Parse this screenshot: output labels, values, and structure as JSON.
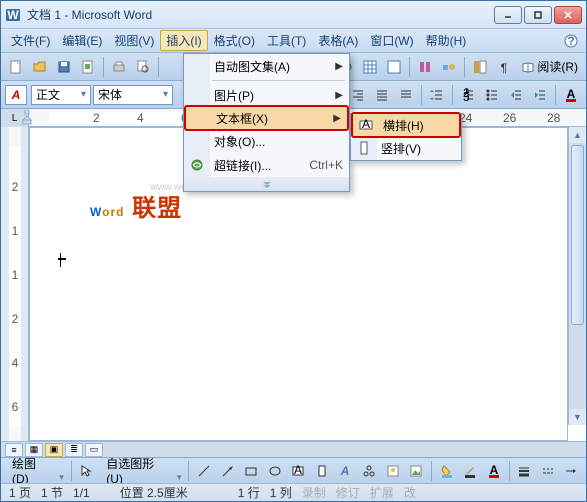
{
  "title": "文档 1 - Microsoft Word",
  "menubar": {
    "file": "文件(F)",
    "edit": "编辑(E)",
    "view": "视图(V)",
    "insert": "插入(I)",
    "format": "格式(O)",
    "tools": "工具(T)",
    "table": "表格(A)",
    "window": "窗口(W)",
    "help": "帮助(H)"
  },
  "toolbar2": {
    "style": "正文",
    "font": "宋体",
    "read": "阅读(R)"
  },
  "insert_menu": {
    "auto_text": "自动图文集(A)",
    "picture": "图片(P)",
    "textbox": "文本框(X)",
    "object": "对象(O)...",
    "hyperlink": "超链接(I)...",
    "hyperlink_shortcut": "Ctrl+K"
  },
  "textbox_submenu": {
    "horizontal": "横排(H)",
    "vertical": "竖排(V)"
  },
  "watermark": {
    "url": "www.wordlm.com",
    "p1": "W",
    "p2": "ord",
    "p3": " 联盟"
  },
  "drawbar": {
    "draw": "绘图(D)",
    "autoshape": "自选图形(U)"
  },
  "status": {
    "page": "1 页",
    "sec": "1 节",
    "pages": "1/1",
    "pos": "位置 2.5厘米",
    "line": "1 行",
    "col": "1 列",
    "rec": "录制",
    "rev": "修订",
    "ext": "扩展",
    "ovr": "改"
  }
}
